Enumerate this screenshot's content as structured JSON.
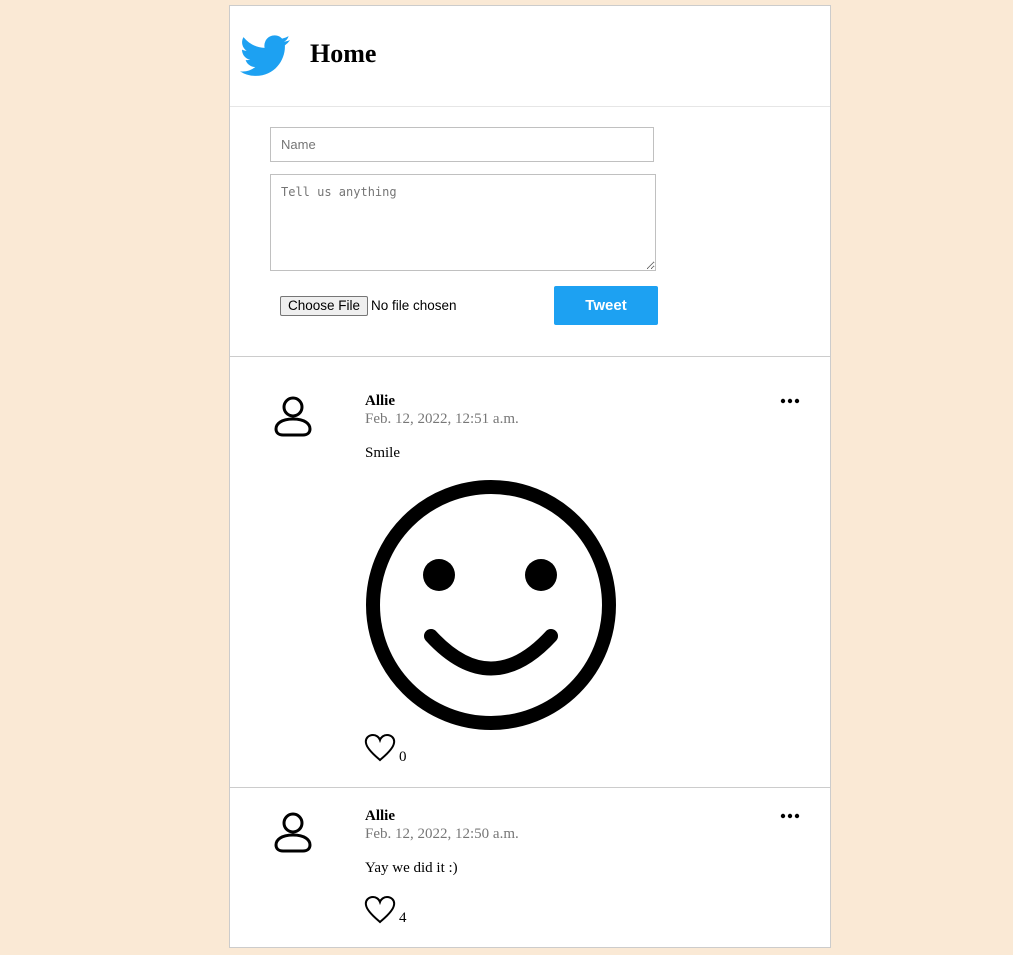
{
  "header": {
    "title": "Home",
    "logo": "twitter-bird-icon",
    "brand_color": "#1da1f2"
  },
  "compose": {
    "name_placeholder": "Name",
    "text_placeholder": "Tell us anything",
    "file_button_label": "Choose File",
    "file_status": "No file chosen",
    "submit_label": "Tweet"
  },
  "tweets": [
    {
      "author": "Allie",
      "timestamp": "Feb. 12, 2022, 12:51 a.m.",
      "text": "Smile",
      "image": "smiley-face",
      "likes": "0"
    },
    {
      "author": "Allie",
      "timestamp": "Feb. 12, 2022, 12:50 a.m.",
      "text": "Yay we did it :)",
      "likes": "4"
    }
  ],
  "colors": {
    "page_background": "#fae9d5",
    "card": "#ffffff",
    "accent": "#1da1f2",
    "muted_text": "#777777"
  }
}
